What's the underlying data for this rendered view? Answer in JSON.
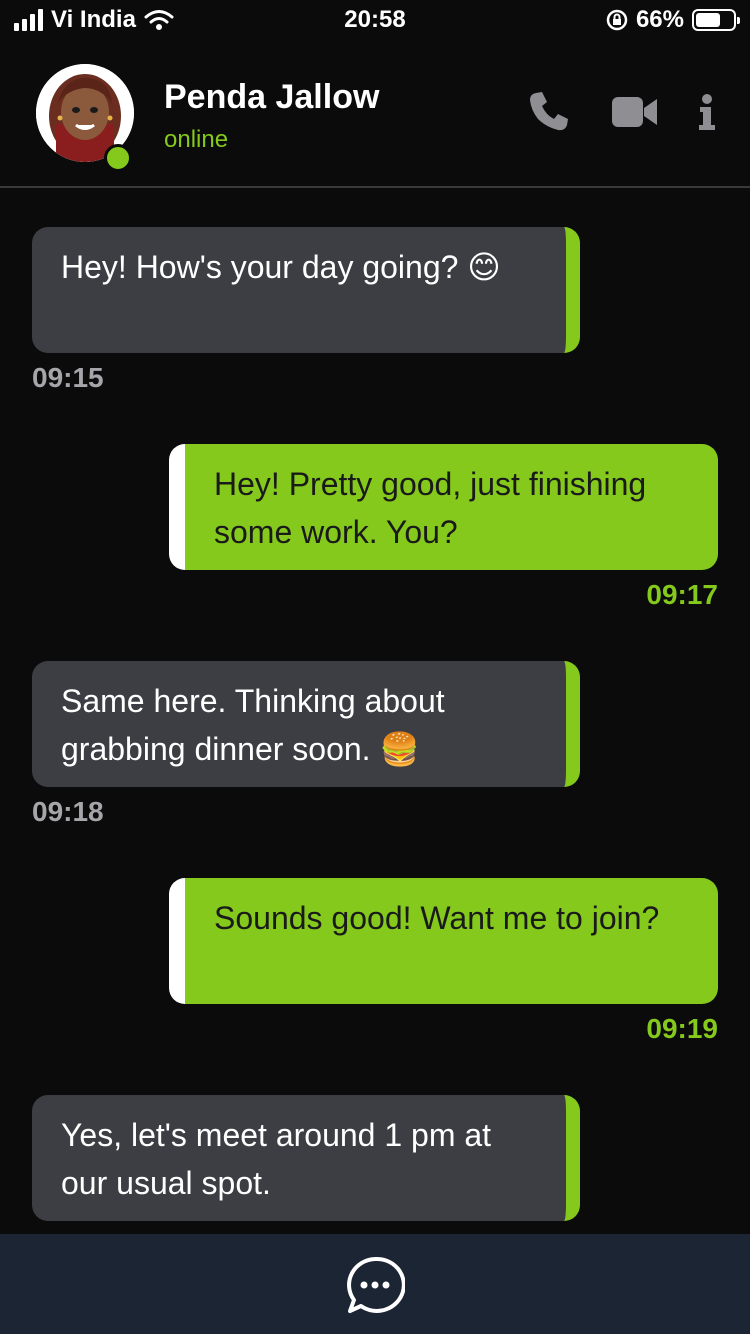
{
  "status_bar": {
    "carrier": "Vi India",
    "time": "20:58",
    "battery_percent": "66%",
    "battery_level": 0.66,
    "icons": [
      "signal-icon",
      "wifi-icon",
      "orientation-lock-icon",
      "battery-icon"
    ]
  },
  "header": {
    "contact_name": "Penda Jallow",
    "contact_status": "online",
    "actions": [
      "phone-icon",
      "video-icon",
      "info-icon"
    ]
  },
  "messages": [
    {
      "direction": "incoming",
      "text": "Hey! How's your day going? 😊",
      "time": "09:15"
    },
    {
      "direction": "outgoing",
      "text": "Hey! Pretty good, just finishing some work. You?",
      "time": "09:17"
    },
    {
      "direction": "incoming",
      "text": "Same here. Thinking about grabbing dinner soon. 🍔",
      "time": "09:18"
    },
    {
      "direction": "outgoing",
      "text": "Sounds good! Want me to join?",
      "time": "09:19"
    },
    {
      "direction": "incoming",
      "text": "Yes, let's meet around 1 pm at our usual spot.",
      "time": ""
    }
  ],
  "bottom_bar": {
    "compose_icon": "chat-bubble-icon"
  },
  "colors": {
    "accent": "#84c91c",
    "background": "#0b0b0b",
    "incoming_bubble": "#3d3e43",
    "bottom_bar": "#1c2533"
  }
}
